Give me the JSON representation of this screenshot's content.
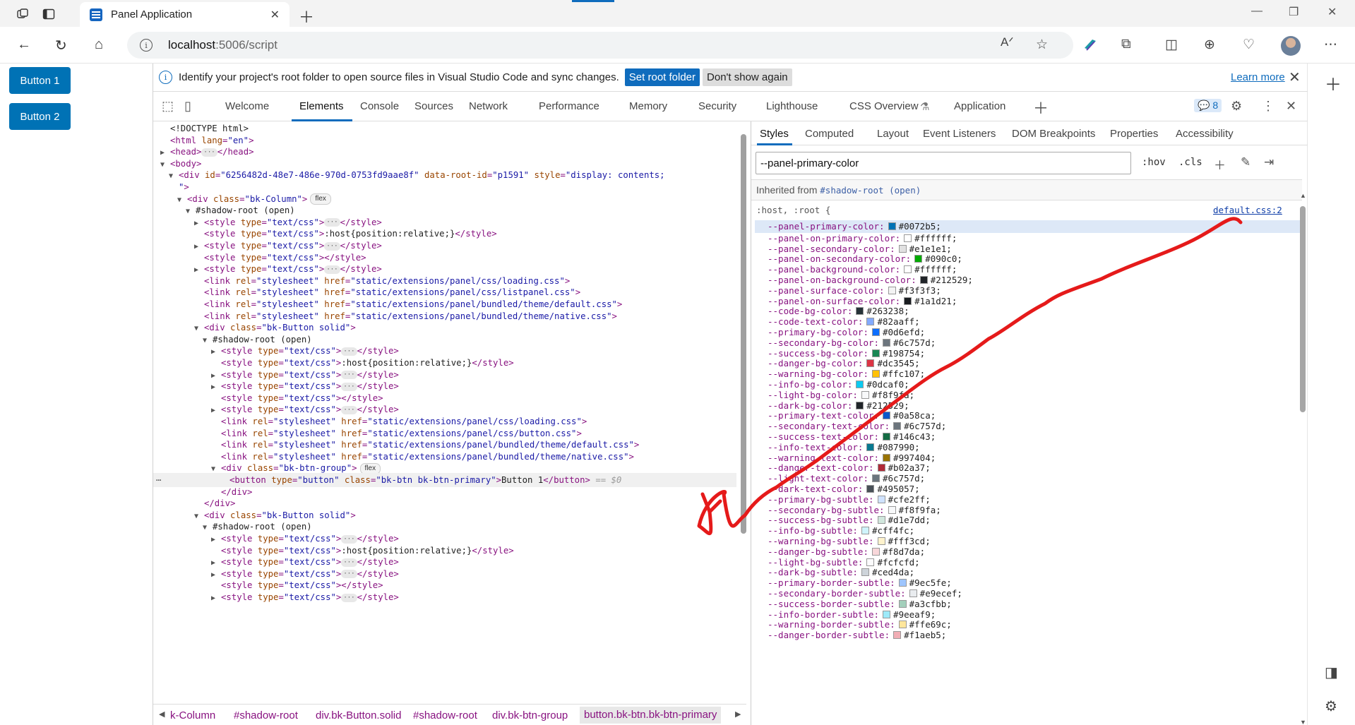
{
  "browser": {
    "tab_title": "Panel Application",
    "url_host": "localhost",
    "url_path": ":5006/script"
  },
  "page": {
    "buttons": [
      "Button 1",
      "Button 2"
    ],
    "accent_color": "#0072b5"
  },
  "devtools": {
    "infobar": {
      "message": "Identify your project's root folder to open source files in Visual Studio Code and sync changes.",
      "set_root": "Set root folder",
      "dont_show": "Don't show again",
      "learn_more": "Learn more"
    },
    "tabs": [
      "Welcome",
      "Elements",
      "Console",
      "Sources",
      "Network",
      "Performance",
      "Memory",
      "Security",
      "Lighthouse",
      "CSS Overview",
      "Application"
    ],
    "active_tab": "Elements",
    "issues_count": "8",
    "breadcrumbs": [
      "k-Column",
      "#shadow-root",
      "div.bk-Button.solid",
      "#shadow-root",
      "div.bk-btn-group",
      "button.bk-btn.bk-btn-primary"
    ],
    "styles_tabs": [
      "Styles",
      "Computed",
      "Layout",
      "Event Listeners",
      "DOM Breakpoints",
      "Properties",
      "Accessibility"
    ],
    "filter_value": "--panel-primary-color",
    "filter_tools": [
      ":hov",
      ".cls"
    ],
    "inherited_label": "Inherited from",
    "inherited_source": "#shadow-root (open)",
    "rule_selector": ":host, :root {",
    "rule_source": "default.css:2",
    "selected_marker": "== $0",
    "properties": [
      {
        "name": "--panel-primary-color:",
        "value": "#0072b5;"
      },
      {
        "name": "--panel-on-primary-color:",
        "value": "#ffffff;"
      },
      {
        "name": "--panel-secondary-color:",
        "value": "#e1e1e1;"
      },
      {
        "name": "--panel-on-secondary-color:",
        "value": "#090c0;"
      },
      {
        "name": "--panel-background-color:",
        "value": "#ffffff;"
      },
      {
        "name": "--panel-on-background-color:",
        "value": "#212529;"
      },
      {
        "name": "--panel-surface-color:",
        "value": "#f3f3f3;"
      },
      {
        "name": "--panel-on-surface-color:",
        "value": "#1a1d21;"
      },
      {
        "name": "--code-bg-color:",
        "value": "#263238;"
      },
      {
        "name": "--code-text-color:",
        "value": "#82aaff;"
      },
      {
        "name": "--primary-bg-color:",
        "value": "#0d6efd;"
      },
      {
        "name": "--secondary-bg-color:",
        "value": "#6c757d;"
      },
      {
        "name": "--success-bg-color:",
        "value": "#198754;"
      },
      {
        "name": "--danger-bg-color:",
        "value": "#dc3545;"
      },
      {
        "name": "--warning-bg-color:",
        "value": "#ffc107;"
      },
      {
        "name": "--info-bg-color:",
        "value": "#0dcaf0;"
      },
      {
        "name": "--light-bg-color:",
        "value": "#f8f9fa;"
      },
      {
        "name": "--dark-bg-color:",
        "value": "#212529;"
      },
      {
        "name": "--primary-text-color:",
        "value": "#0a58ca;"
      },
      {
        "name": "--secondary-text-color:",
        "value": "#6c757d;"
      },
      {
        "name": "--success-text-color:",
        "value": "#146c43;"
      },
      {
        "name": "--info-text-color:",
        "value": "#087990;"
      },
      {
        "name": "--warning-text-color:",
        "value": "#997404;"
      },
      {
        "name": "--danger-text-color:",
        "value": "#b02a37;"
      },
      {
        "name": "--light-text-color:",
        "value": "#6c757d;"
      },
      {
        "name": "--dark-text-color:",
        "value": "#495057;"
      },
      {
        "name": "--primary-bg-subtle:",
        "value": "#cfe2ff;"
      },
      {
        "name": "--secondary-bg-subtle:",
        "value": "#f8f9fa;"
      },
      {
        "name": "--success-bg-subtle:",
        "value": "#d1e7dd;"
      },
      {
        "name": "--info-bg-subtle:",
        "value": "#cff4fc;"
      },
      {
        "name": "--warning-bg-subtle:",
        "value": "#fff3cd;"
      },
      {
        "name": "--danger-bg-subtle:",
        "value": "#f8d7da;"
      },
      {
        "name": "--light-bg-subtle:",
        "value": "#fcfcfd;"
      },
      {
        "name": "--dark-bg-subtle:",
        "value": "#ced4da;"
      },
      {
        "name": "--primary-border-subtle:",
        "value": "#9ec5fe;"
      },
      {
        "name": "--secondary-border-subtle:",
        "value": "#e9ecef;"
      },
      {
        "name": "--success-border-subtle:",
        "value": "#a3cfbb;"
      },
      {
        "name": "--info-border-subtle:",
        "value": "#9eeaf9;"
      },
      {
        "name": "--warning-border-subtle:",
        "value": "#ffe69c;"
      },
      {
        "name": "--danger-border-subtle:",
        "value": "#f1aeb5;"
      }
    ],
    "swatch_colors": [
      "#0072b5",
      "#ffffff",
      "#e1e1e1",
      "#00aa00",
      "#ffffff",
      "#212529",
      "#f3f3f3",
      "#1a1d21",
      "#263238",
      "#82aaff",
      "#0d6efd",
      "#6c757d",
      "#198754",
      "#dc3545",
      "#ffc107",
      "#0dcaf0",
      "#f8f9fa",
      "#212529",
      "#0a58ca",
      "#6c757d",
      "#146c43",
      "#087990",
      "#997404",
      "#b02a37",
      "#6c757d",
      "#495057",
      "#cfe2ff",
      "#f8f9fa",
      "#d1e7dd",
      "#cff4fc",
      "#fff3cd",
      "#f8d7da",
      "#fcfcfd",
      "#ced4da",
      "#9ec5fe",
      "#e9ecef",
      "#a3cfbb",
      "#9eeaf9",
      "#ffe69c",
      "#f1aeb5"
    ],
    "dom_tree": [
      {
        "indent": 0,
        "arrow": "",
        "html": "<span class='txt'>&lt;!DOCTYPE html&gt;</span>"
      },
      {
        "indent": 0,
        "arrow": "",
        "html": "<span class='tag'>&lt;html </span><span class='attr'>lang</span><span class='tag'>=</span><span class='val'>\"en\"</span><span class='tag'>&gt;</span>"
      },
      {
        "indent": 0,
        "arrow": "▶",
        "html": "<span class='tag'>&lt;head&gt;</span><span class='dots'>···</span><span class='tag'>&lt;/head&gt;</span>"
      },
      {
        "indent": 0,
        "arrow": "▼",
        "html": "<span class='tag'>&lt;body&gt;</span>"
      },
      {
        "indent": 1,
        "arrow": "▼",
        "html": "<span class='tag'>&lt;div </span><span class='attr'>id</span><span class='tag'>=</span><span class='val'>\"6256482d-48e7-486e-970d-0753fd9aae8f\"</span> <span class='attr'>data-root-id</span><span class='tag'>=</span><span class='val'>\"p1591\"</span> <span class='attr'>style</span><span class='tag'>=</span><span class='val'>\"display: contents;</span>"
      },
      {
        "indent": 1,
        "arrow": "",
        "html": "<span class='val'>\"</span><span class='tag'>&gt;</span>"
      },
      {
        "indent": 2,
        "arrow": "▼",
        "html": "<span class='tag'>&lt;div </span><span class='attr'>class</span><span class='tag'>=</span><span class='val'>\"bk-Column\"</span><span class='tag'>&gt;</span><span class='flex-badge'>flex</span>"
      },
      {
        "indent": 3,
        "arrow": "▼",
        "html": "<span class='txt'>#shadow-root (open)</span>"
      },
      {
        "indent": 4,
        "arrow": "▶",
        "html": "<span class='tag'>&lt;style </span><span class='attr'>type</span><span class='tag'>=</span><span class='val'>\"text/css\"</span><span class='tag'>&gt;</span><span class='dots'>···</span><span class='tag'>&lt;/style&gt;</span>"
      },
      {
        "indent": 4,
        "arrow": "",
        "html": "<span class='tag'>&lt;style </span><span class='attr'>type</span><span class='tag'>=</span><span class='val'>\"text/css\"</span><span class='tag'>&gt;</span><span class='txt'>:host{position:relative;}</span><span class='tag'>&lt;/style&gt;</span>"
      },
      {
        "indent": 4,
        "arrow": "▶",
        "html": "<span class='tag'>&lt;style </span><span class='attr'>type</span><span class='tag'>=</span><span class='val'>\"text/css\"</span><span class='tag'>&gt;</span><span class='dots'>···</span><span class='tag'>&lt;/style&gt;</span>"
      },
      {
        "indent": 4,
        "arrow": "",
        "html": "<span class='tag'>&lt;style </span><span class='attr'>type</span><span class='tag'>=</span><span class='val'>\"text/css\"</span><span class='tag'>&gt;&lt;/style&gt;</span>"
      },
      {
        "indent": 4,
        "arrow": "▶",
        "html": "<span class='tag'>&lt;style </span><span class='attr'>type</span><span class='tag'>=</span><span class='val'>\"text/css\"</span><span class='tag'>&gt;</span><span class='dots'>···</span><span class='tag'>&lt;/style&gt;</span>"
      },
      {
        "indent": 4,
        "arrow": "",
        "html": "<span class='tag'>&lt;link </span><span class='attr'>rel</span><span class='tag'>=</span><span class='val'>\"stylesheet\"</span> <span class='attr'>href</span><span class='tag'>=</span><span class='val'>\"static/extensions/panel/css/loading.css\"</span><span class='tag'>&gt;</span>"
      },
      {
        "indent": 4,
        "arrow": "",
        "html": "<span class='tag'>&lt;link </span><span class='attr'>rel</span><span class='tag'>=</span><span class='val'>\"stylesheet\"</span> <span class='attr'>href</span><span class='tag'>=</span><span class='val'>\"static/extensions/panel/css/listpanel.css\"</span><span class='tag'>&gt;</span>"
      },
      {
        "indent": 4,
        "arrow": "",
        "html": "<span class='tag'>&lt;link </span><span class='attr'>rel</span><span class='tag'>=</span><span class='val'>\"stylesheet\"</span> <span class='attr'>href</span><span class='tag'>=</span><span class='val'>\"static/extensions/panel/bundled/theme/default.css\"</span><span class='tag'>&gt;</span>"
      },
      {
        "indent": 4,
        "arrow": "",
        "html": "<span class='tag'>&lt;link </span><span class='attr'>rel</span><span class='tag'>=</span><span class='val'>\"stylesheet\"</span> <span class='attr'>href</span><span class='tag'>=</span><span class='val'>\"static/extensions/panel/bundled/theme/native.css\"</span><span class='tag'>&gt;</span>"
      },
      {
        "indent": 4,
        "arrow": "▼",
        "html": "<span class='tag'>&lt;div </span><span class='attr'>class</span><span class='tag'>=</span><span class='val'>\"bk-Button solid\"</span><span class='tag'>&gt;</span>"
      },
      {
        "indent": 5,
        "arrow": "▼",
        "html": "<span class='txt'>#shadow-root (open)</span>"
      },
      {
        "indent": 6,
        "arrow": "▶",
        "html": "<span class='tag'>&lt;style </span><span class='attr'>type</span><span class='tag'>=</span><span class='val'>\"text/css\"</span><span class='tag'>&gt;</span><span class='dots'>···</span><span class='tag'>&lt;/style&gt;</span>"
      },
      {
        "indent": 6,
        "arrow": "",
        "html": "<span class='tag'>&lt;style </span><span class='attr'>type</span><span class='tag'>=</span><span class='val'>\"text/css\"</span><span class='tag'>&gt;</span><span class='txt'>:host{position:relative;}</span><span class='tag'>&lt;/style&gt;</span>"
      },
      {
        "indent": 6,
        "arrow": "▶",
        "html": "<span class='tag'>&lt;style </span><span class='attr'>type</span><span class='tag'>=</span><span class='val'>\"text/css\"</span><span class='tag'>&gt;</span><span class='dots'>···</span><span class='tag'>&lt;/style&gt;</span>"
      },
      {
        "indent": 6,
        "arrow": "▶",
        "html": "<span class='tag'>&lt;style </span><span class='attr'>type</span><span class='tag'>=</span><span class='val'>\"text/css\"</span><span class='tag'>&gt;</span><span class='dots'>···</span><span class='tag'>&lt;/style&gt;</span>"
      },
      {
        "indent": 6,
        "arrow": "",
        "html": "<span class='tag'>&lt;style </span><span class='attr'>type</span><span class='tag'>=</span><span class='val'>\"text/css\"</span><span class='tag'>&gt;&lt;/style&gt;</span>"
      },
      {
        "indent": 6,
        "arrow": "▶",
        "html": "<span class='tag'>&lt;style </span><span class='attr'>type</span><span class='tag'>=</span><span class='val'>\"text/css\"</span><span class='tag'>&gt;</span><span class='dots'>···</span><span class='tag'>&lt;/style&gt;</span>"
      },
      {
        "indent": 6,
        "arrow": "",
        "html": "<span class='tag'>&lt;link </span><span class='attr'>rel</span><span class='tag'>=</span><span class='val'>\"stylesheet\"</span> <span class='attr'>href</span><span class='tag'>=</span><span class='val'>\"static/extensions/panel/css/loading.css\"</span><span class='tag'>&gt;</span>"
      },
      {
        "indent": 6,
        "arrow": "",
        "html": "<span class='tag'>&lt;link </span><span class='attr'>rel</span><span class='tag'>=</span><span class='val'>\"stylesheet\"</span> <span class='attr'>href</span><span class='tag'>=</span><span class='val'>\"static/extensions/panel/css/button.css\"</span><span class='tag'>&gt;</span>"
      },
      {
        "indent": 6,
        "arrow": "",
        "html": "<span class='tag'>&lt;link </span><span class='attr'>rel</span><span class='tag'>=</span><span class='val'>\"stylesheet\"</span> <span class='attr'>href</span><span class='tag'>=</span><span class='val'>\"static/extensions/panel/bundled/theme/default.css\"</span><span class='tag'>&gt;</span>"
      },
      {
        "indent": 6,
        "arrow": "",
        "html": "<span class='tag'>&lt;link </span><span class='attr'>rel</span><span class='tag'>=</span><span class='val'>\"stylesheet\"</span> <span class='attr'>href</span><span class='tag'>=</span><span class='val'>\"static/extensions/panel/bundled/theme/native.css\"</span><span class='tag'>&gt;</span>"
      },
      {
        "indent": 6,
        "arrow": "▼",
        "html": "<span class='tag'>&lt;div </span><span class='attr'>class</span><span class='tag'>=</span><span class='val'>\"bk-btn-group\"</span><span class='tag'>&gt;</span><span class='flex-badge'>flex</span>"
      },
      {
        "indent": 7,
        "arrow": "",
        "selected": true,
        "html": "<span class='tag'>&lt;button </span><span class='attr'>type</span><span class='tag'>=</span><span class='val'>\"button\"</span> <span class='attr'>class</span><span class='tag'>=</span><span class='val'>\"bk-btn bk-btn-primary\"</span><span class='tag'>&gt;</span><span class='txt'>Button 1</span><span class='tag'>&lt;/button&gt;</span> <span class='eq0'>== $0</span>"
      },
      {
        "indent": 6,
        "arrow": "",
        "html": "<span class='tag'>&lt;/div&gt;</span>"
      },
      {
        "indent": 4,
        "arrow": "",
        "html": "<span class='tag'>&lt;/div&gt;</span>"
      },
      {
        "indent": 4,
        "arrow": "▼",
        "html": "<span class='tag'>&lt;div </span><span class='attr'>class</span><span class='tag'>=</span><span class='val'>\"bk-Button solid\"</span><span class='tag'>&gt;</span>"
      },
      {
        "indent": 5,
        "arrow": "▼",
        "html": "<span class='txt'>#shadow-root (open)</span>"
      },
      {
        "indent": 6,
        "arrow": "▶",
        "html": "<span class='tag'>&lt;style </span><span class='attr'>type</span><span class='tag'>=</span><span class='val'>\"text/css\"</span><span class='tag'>&gt;</span><span class='dots'>···</span><span class='tag'>&lt;/style&gt;</span>"
      },
      {
        "indent": 6,
        "arrow": "",
        "html": "<span class='tag'>&lt;style </span><span class='attr'>type</span><span class='tag'>=</span><span class='val'>\"text/css\"</span><span class='tag'>&gt;</span><span class='txt'>:host{position:relative;}</span><span class='tag'>&lt;/style&gt;</span>"
      },
      {
        "indent": 6,
        "arrow": "▶",
        "html": "<span class='tag'>&lt;style </span><span class='attr'>type</span><span class='tag'>=</span><span class='val'>\"text/css\"</span><span class='tag'>&gt;</span><span class='dots'>···</span><span class='tag'>&lt;/style&gt;</span>"
      },
      {
        "indent": 6,
        "arrow": "▶",
        "html": "<span class='tag'>&lt;style </span><span class='attr'>type</span><span class='tag'>=</span><span class='val'>\"text/css\"</span><span class='tag'>&gt;</span><span class='dots'>···</span><span class='tag'>&lt;/style&gt;</span>"
      },
      {
        "indent": 6,
        "arrow": "",
        "html": "<span class='tag'>&lt;style </span><span class='attr'>type</span><span class='tag'>=</span><span class='val'>\"text/css\"</span><span class='tag'>&gt;&lt;/style&gt;</span>"
      },
      {
        "indent": 6,
        "arrow": "▶",
        "html": "<span class='tag'>&lt;style </span><span class='attr'>type</span><span class='tag'>=</span><span class='val'>\"text/css\"</span><span class='tag'>&gt;</span><span class='dots'>···</span><span class='tag'>&lt;/style&gt;</span>"
      }
    ]
  }
}
